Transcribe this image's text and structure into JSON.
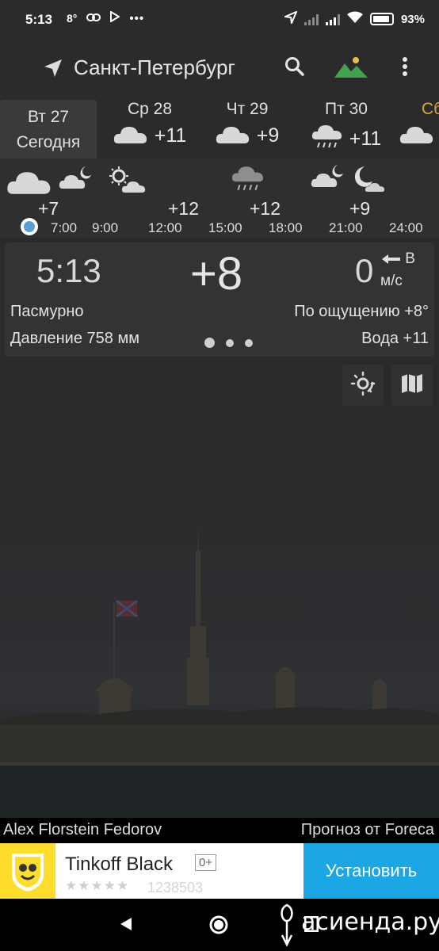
{
  "status_bar": {
    "time": "5:13",
    "temp_indicator": "8°",
    "battery": "93%",
    "icons": [
      "link-icon",
      "play-icon",
      "more-notifications-icon",
      "location-arrow-icon",
      "signal-icon",
      "wifi-icon",
      "battery-icon"
    ]
  },
  "toolbar": {
    "city": "Санкт-Петербург",
    "icons": [
      "location-icon",
      "search-icon",
      "landscape-icon",
      "more-vert-icon"
    ],
    "accent_color": "#3fa34d"
  },
  "days": [
    {
      "label": "Вт 27",
      "sub": "Сегодня",
      "selected": true
    },
    {
      "label": "Ср 28",
      "temp": "+11",
      "icon": "cloudy-icon"
    },
    {
      "label": "Чт 29",
      "temp": "+9",
      "icon": "cloudy-icon"
    },
    {
      "label": "Пт 30",
      "temp": "+11",
      "icon": "rain-icon"
    },
    {
      "label": "Сб",
      "icon": "cloudy-icon",
      "weekend": true
    }
  ],
  "hourly": {
    "temps": [
      "+7",
      "+12",
      "+12",
      "+9"
    ],
    "times": [
      "7:00",
      "9:00",
      "12:00",
      "15:00",
      "18:00",
      "21:00",
      "24:00"
    ],
    "icons": [
      "cloudy-icon",
      "night-cloudy-icon",
      "partly-sunny-icon",
      "rain-icon",
      "night-cloudy-icon",
      "night-clear-icon"
    ],
    "now_color": "#5b9fd3"
  },
  "current": {
    "time": "5:13",
    "temp": "+8",
    "wind_value": "0",
    "wind_dir": "В",
    "wind_unit": "м/с",
    "condition": "Пасмурно",
    "pressure": "Давление 758 мм",
    "feels_like": "По ощущению +8°",
    "water": "Вода +11"
  },
  "buttons": [
    "sun-radar-icon",
    "map-icon"
  ],
  "credits": {
    "author": "Alex Florstein Fedorov",
    "source": "Прогноз от Foreca"
  },
  "ad": {
    "title": "Tinkoff Black",
    "age": "0+",
    "rating": "★★★★★",
    "count": "1238503",
    "install": "Установить",
    "brand_color": "#ffdd2d",
    "button_color": "#1ba7e6"
  },
  "navbar": {
    "watermark": "асиенда.ру"
  }
}
